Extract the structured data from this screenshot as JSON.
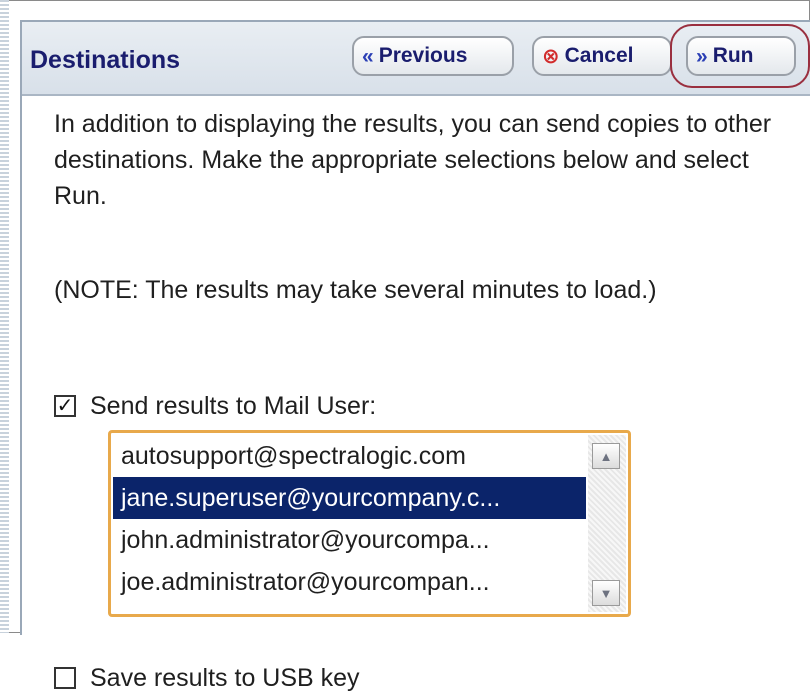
{
  "header": {
    "title": "Destinations",
    "buttons": {
      "previous": "Previous",
      "cancel": "Cancel",
      "run": "Run"
    }
  },
  "content": {
    "paragraph1": "In addition to displaying the results, you can send copies to other destinations. Make the appropriate selections below and select Run.",
    "paragraph2": "(NOTE: The results may take several minutes to load.)",
    "mail_option": {
      "label": "Send results to Mail User:",
      "checked": true
    },
    "mail_list": {
      "items": [
        "autosupport@spectralogic.com",
        "jane.superuser@yourcompany.c...",
        "john.administrator@yourcompa...",
        "joe.administrator@yourcompan..."
      ],
      "selected_index": 1
    },
    "usb_option": {
      "label": "Save results to USB key",
      "checked": false
    }
  }
}
